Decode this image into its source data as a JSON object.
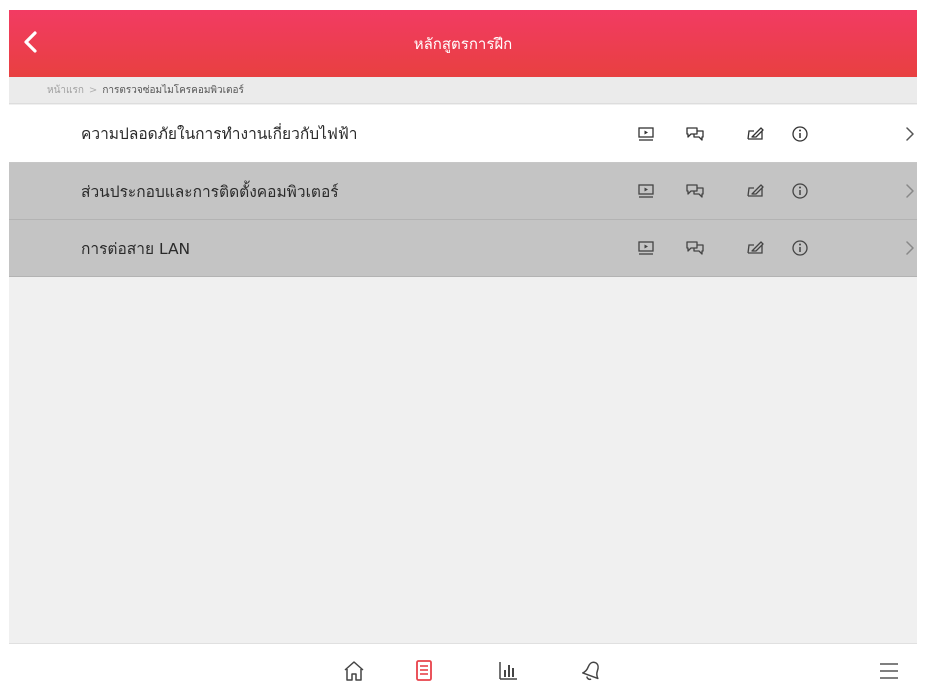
{
  "header": {
    "title": "หลักสูตรการฝึก",
    "back_icon": "chevron-left-icon"
  },
  "breadcrumb": {
    "home": "หน้าแรก",
    "separator": ">",
    "current": "การตรวจซ่อมไมโครคอมพิวเตอร์"
  },
  "lessons": [
    {
      "title": "ความปลอดภัยในการทำงานเกี่ยวกับไฟฟ้า",
      "state": "active"
    },
    {
      "title": "ส่วนประกอบและการติดตั้งคอมพิวเตอร์",
      "state": "disabled"
    },
    {
      "title": "การต่อสาย LAN",
      "state": "disabled"
    }
  ],
  "row_icons": [
    "video-icon",
    "chat-icon",
    "edit-icon",
    "info-icon",
    "chevron-right-icon"
  ],
  "bottom_nav": [
    "home-icon",
    "course-icon",
    "stats-icon",
    "bell-icon",
    "menu-icon"
  ],
  "colors": {
    "header_top": "#f23b63",
    "header_bottom": "#e84040",
    "accent": "#e8424a",
    "active_row": "#ffffff",
    "disabled_row": "#c4c4c4",
    "background": "#f0f0f0"
  }
}
